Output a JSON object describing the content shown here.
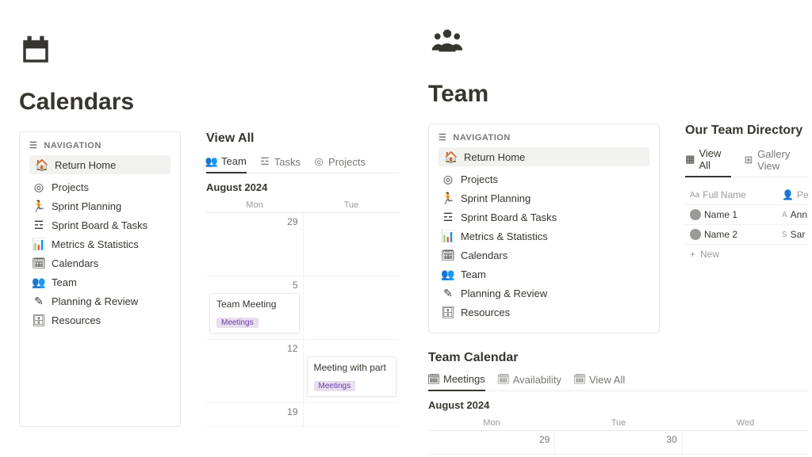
{
  "left": {
    "title": "Calendars",
    "nav": {
      "heading": "NAVIGATION",
      "home": "Return Home",
      "items": [
        "Projects",
        "Sprint Planning",
        "Sprint Board & Tasks",
        "Metrics & Statistics",
        "Calendars",
        "Team",
        "Planning & Review",
        "Resources"
      ]
    },
    "view_all": "View All",
    "tabs": [
      "Team",
      "Tasks",
      "Projects"
    ],
    "month": "August 2024",
    "day_labels": [
      "Mon",
      "Tue"
    ],
    "cells": {
      "r0c0": "29",
      "r1c0": "5",
      "r2c0": "12",
      "r3c0": "19"
    },
    "events": {
      "e1": {
        "title": "Team Meeting",
        "tag": "Meetings"
      },
      "e2": {
        "title": "Meeting with part",
        "tag": "Meetings"
      }
    }
  },
  "right": {
    "title": "Team",
    "nav": {
      "heading": "NAVIGATION",
      "home": "Return Home",
      "items": [
        "Projects",
        "Sprint Planning",
        "Sprint Board & Tasks",
        "Metrics & Statistics",
        "Calendars",
        "Team",
        "Planning & Review",
        "Resources"
      ]
    },
    "directory": {
      "heading": "Our Team Directory",
      "tabs": [
        "View All",
        "Gallery View"
      ],
      "cols": [
        "Full Name",
        "Pers"
      ],
      "col_prefix": {
        "c1": "Aa"
      },
      "rows": [
        {
          "name": "Name 1",
          "letter": "A",
          "value": "Ann"
        },
        {
          "name": "Name 2",
          "letter": "S",
          "value": "Sar"
        }
      ],
      "new": "New"
    },
    "team_calendar": {
      "heading": "Team Calendar",
      "tabs": [
        "Meetings",
        "Availability",
        "View All"
      ],
      "month": "August 2024",
      "day_labels": [
        "Mon",
        "Tue",
        "Wed"
      ],
      "days": [
        "29",
        "30"
      ]
    }
  }
}
